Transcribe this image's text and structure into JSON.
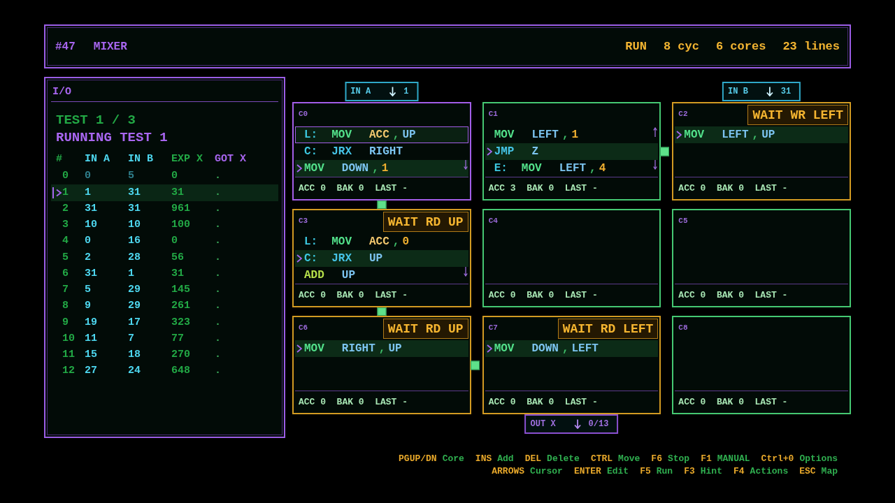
{
  "header": {
    "puzzle_number": "#47",
    "puzzle_name": "MIXER",
    "run_state": "RUN",
    "stats": [
      "8 cyc",
      "6 cores",
      "23 lines"
    ]
  },
  "io_panel": {
    "title": "I/O",
    "test_counter": "TEST 1 / 3",
    "run_status": "RUNNING TEST 1",
    "columns": [
      {
        "label": "#",
        "kind": "index"
      },
      {
        "label": "IN A",
        "kind": "input"
      },
      {
        "label": "IN B",
        "kind": "input"
      },
      {
        "label": "EXP X",
        "kind": "expected"
      },
      {
        "label": "GOT X",
        "kind": "output"
      }
    ],
    "rows": [
      {
        "cells": [
          "0",
          "0",
          "5",
          "0",
          "."
        ],
        "selected": false,
        "consumed": true
      },
      {
        "cells": [
          "1",
          "1",
          "31",
          "31",
          "."
        ],
        "selected": true,
        "consumed": false
      },
      {
        "cells": [
          "2",
          "31",
          "31",
          "961",
          "."
        ],
        "selected": false,
        "consumed": false
      },
      {
        "cells": [
          "3",
          "10",
          "10",
          "100",
          "."
        ],
        "selected": false,
        "consumed": false
      },
      {
        "cells": [
          "4",
          "0",
          "16",
          "0",
          "."
        ],
        "selected": false,
        "consumed": false
      },
      {
        "cells": [
          "5",
          "2",
          "28",
          "56",
          "."
        ],
        "selected": false,
        "consumed": false
      },
      {
        "cells": [
          "6",
          "31",
          "1",
          "31",
          "."
        ],
        "selected": false,
        "consumed": false
      },
      {
        "cells": [
          "7",
          "5",
          "29",
          "145",
          "."
        ],
        "selected": false,
        "consumed": false
      },
      {
        "cells": [
          "8",
          "9",
          "29",
          "261",
          "."
        ],
        "selected": false,
        "consumed": false
      },
      {
        "cells": [
          "9",
          "19",
          "17",
          "323",
          "."
        ],
        "selected": false,
        "consumed": false
      },
      {
        "cells": [
          "10",
          "11",
          "7",
          "77",
          "."
        ],
        "selected": false,
        "consumed": false
      },
      {
        "cells": [
          "11",
          "15",
          "18",
          "270",
          "."
        ],
        "selected": false,
        "consumed": false
      },
      {
        "cells": [
          "12",
          "27",
          "24",
          "648",
          "."
        ],
        "selected": false,
        "consumed": false
      }
    ]
  },
  "input_ports": [
    {
      "label": "IN A",
      "value": "1"
    },
    {
      "label": "IN B",
      "value": "31"
    }
  ],
  "cores": [
    {
      "label": "C0",
      "selected": true,
      "input_above": true,
      "output_below": false,
      "more_above": false,
      "more_below": true,
      "signal_right": false,
      "signal_down": true,
      "lines": [
        {
          "current": false,
          "cursor": true,
          "tokens": [
            {
              "kind": "label",
              "text": "L:"
            },
            {
              "kind": "op",
              "text": "MOV"
            },
            {
              "kind": "reg",
              "text": "ACC"
            },
            {
              "kind": "comma",
              "text": ","
            },
            {
              "kind": "port",
              "text": "UP"
            }
          ]
        },
        {
          "current": false,
          "cursor": false,
          "tokens": [
            {
              "kind": "label",
              "text": "C:"
            },
            {
              "kind": "jump",
              "text": "JRX"
            },
            {
              "kind": "port",
              "text": "RIGHT"
            }
          ]
        },
        {
          "current": true,
          "cursor": false,
          "tokens": [
            {
              "kind": "op",
              "text": "MOV"
            },
            {
              "kind": "port",
              "text": "DOWN"
            },
            {
              "kind": "comma",
              "text": ","
            },
            {
              "kind": "num",
              "text": "1"
            }
          ]
        }
      ],
      "stats": "ACC 0  BAK 0  LAST -"
    },
    {
      "label": "C1",
      "selected": false,
      "input_above": false,
      "output_below": false,
      "more_above": true,
      "more_below": true,
      "signal_right": true,
      "signal_down": false,
      "lines": [
        {
          "current": false,
          "cursor": false,
          "tokens": [
            {
              "kind": "op",
              "text": "MOV"
            },
            {
              "kind": "port",
              "text": "LEFT"
            },
            {
              "kind": "comma",
              "text": ","
            },
            {
              "kind": "num",
              "text": "1"
            }
          ]
        },
        {
          "current": true,
          "cursor": false,
          "tokens": [
            {
              "kind": "jump",
              "text": "JMP"
            },
            {
              "kind": "port",
              "text": "Z"
            }
          ]
        },
        {
          "current": false,
          "cursor": false,
          "tokens": [
            {
              "kind": "label",
              "text": "E:"
            },
            {
              "kind": "op",
              "text": "MOV"
            },
            {
              "kind": "port",
              "text": "LEFT"
            },
            {
              "kind": "comma",
              "text": ","
            },
            {
              "kind": "num",
              "text": "4"
            }
          ]
        }
      ],
      "stats": "ACC 3  BAK 0  LAST -"
    },
    {
      "label": "C2",
      "selected": false,
      "badge": "WAIT WR LEFT",
      "input_above": true,
      "output_below": false,
      "more_above": false,
      "more_below": false,
      "signal_right": false,
      "signal_down": false,
      "lines": [
        {
          "current": true,
          "cursor": false,
          "tokens": [
            {
              "kind": "op",
              "text": "MOV"
            },
            {
              "kind": "port",
              "text": "LEFT"
            },
            {
              "kind": "comma",
              "text": ","
            },
            {
              "kind": "port",
              "text": "UP"
            }
          ]
        }
      ],
      "stats": "ACC 0  BAK 0  LAST -"
    },
    {
      "label": "C3",
      "selected": false,
      "badge": "WAIT RD UP",
      "input_above": false,
      "output_below": false,
      "more_above": false,
      "more_below": true,
      "signal_right": false,
      "signal_down": true,
      "lines": [
        {
          "current": false,
          "cursor": false,
          "tokens": [
            {
              "kind": "label",
              "text": "L:"
            },
            {
              "kind": "op",
              "text": "MOV"
            },
            {
              "kind": "reg",
              "text": "ACC"
            },
            {
              "kind": "comma",
              "text": ","
            },
            {
              "kind": "num",
              "text": "0"
            }
          ]
        },
        {
          "current": true,
          "cursor": false,
          "tokens": [
            {
              "kind": "label",
              "text": "C:"
            },
            {
              "kind": "jump",
              "text": "JRX"
            },
            {
              "kind": "port",
              "text": "UP"
            }
          ]
        },
        {
          "current": false,
          "cursor": false,
          "tokens": [
            {
              "kind": "math",
              "text": "ADD"
            },
            {
              "kind": "port",
              "text": "UP"
            }
          ]
        }
      ],
      "stats": "ACC 0  BAK 0  LAST -"
    },
    {
      "label": "C4",
      "selected": false,
      "input_above": false,
      "output_below": false,
      "more_above": false,
      "more_below": false,
      "signal_right": false,
      "signal_down": false,
      "stats": "ACC 0  BAK 0  LAST -"
    },
    {
      "label": "C5",
      "selected": false,
      "input_above": false,
      "output_below": false,
      "more_above": false,
      "more_below": false,
      "signal_right": false,
      "signal_down": false,
      "stats": "ACC 0  BAK 0  LAST -"
    },
    {
      "label": "C6",
      "selected": false,
      "badge": "WAIT RD UP",
      "input_above": false,
      "output_below": false,
      "more_above": false,
      "more_below": false,
      "signal_right": true,
      "signal_down": false,
      "lines": [
        {
          "current": true,
          "cursor": false,
          "tokens": [
            {
              "kind": "op",
              "text": "MOV"
            },
            {
              "kind": "port",
              "text": "RIGHT"
            },
            {
              "kind": "comma",
              "text": ","
            },
            {
              "kind": "port",
              "text": "UP"
            }
          ]
        }
      ],
      "stats": "ACC 0  BAK 0  LAST -"
    },
    {
      "label": "C7",
      "selected": false,
      "badge": "WAIT RD LEFT",
      "input_above": false,
      "output_below": true,
      "more_above": false,
      "more_below": false,
      "signal_right": false,
      "signal_down": false,
      "lines": [
        {
          "current": true,
          "cursor": false,
          "tokens": [
            {
              "kind": "op",
              "text": "MOV"
            },
            {
              "kind": "port",
              "text": "DOWN"
            },
            {
              "kind": "comma",
              "text": ","
            },
            {
              "kind": "port",
              "text": "LEFT"
            }
          ]
        }
      ],
      "stats": "ACC 0  BAK 0  LAST -"
    },
    {
      "label": "C8",
      "selected": false,
      "input_above": false,
      "output_below": false,
      "more_above": false,
      "more_below": false,
      "signal_right": false,
      "signal_down": false,
      "stats": "ACC 0  BAK 0  LAST -"
    }
  ],
  "output_ports": [
    {
      "label": "OUT X",
      "value": "0/13"
    }
  ],
  "key_hints": [
    {
      "items": [
        {
          "key": "PGUP/DN",
          "action": "Core"
        },
        {
          "key": "INS",
          "action": "Add"
        },
        {
          "key": "DEL",
          "action": "Delete"
        },
        {
          "key": "CTRL",
          "action": "Move"
        },
        {
          "key": "F6",
          "action": "Stop"
        },
        {
          "key": "F1",
          "action": "MANUAL"
        },
        {
          "key": "Ctrl+0",
          "action": "Options"
        }
      ]
    },
    {
      "items": [
        {
          "key": "ARROWS",
          "action": "Cursor"
        },
        {
          "key": "ENTER",
          "action": "Edit"
        },
        {
          "key": "F5",
          "action": "Run"
        },
        {
          "key": "F3",
          "action": "Hint"
        },
        {
          "key": "F4",
          "action": "Actions"
        },
        {
          "key": "ESC",
          "action": "Map"
        }
      ]
    }
  ]
}
